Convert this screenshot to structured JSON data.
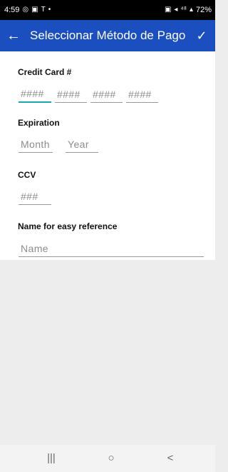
{
  "status_bar": {
    "time": "4:59",
    "left_icons": [
      "◎",
      "▣",
      "T",
      "•"
    ],
    "right_icons": [
      "▣",
      "◂",
      "⁴⁸",
      "▴"
    ],
    "battery": "72%"
  },
  "app_bar": {
    "back_icon": "←",
    "title": "Seleccionar Método de Pago",
    "confirm_icon": "✓"
  },
  "form": {
    "credit_card": {
      "label": "Credit Card #",
      "placeholders": [
        "####",
        "####",
        "####",
        "####"
      ]
    },
    "expiration": {
      "label": "Expiration",
      "month_placeholder": "Month",
      "year_placeholder": "Year"
    },
    "ccv": {
      "label": "CCV",
      "placeholder": "###"
    },
    "reference": {
      "label": "Name for easy reference",
      "placeholder": "Name"
    }
  },
  "nav_bar": {
    "recents": "|||",
    "home": "○",
    "back": "<"
  }
}
